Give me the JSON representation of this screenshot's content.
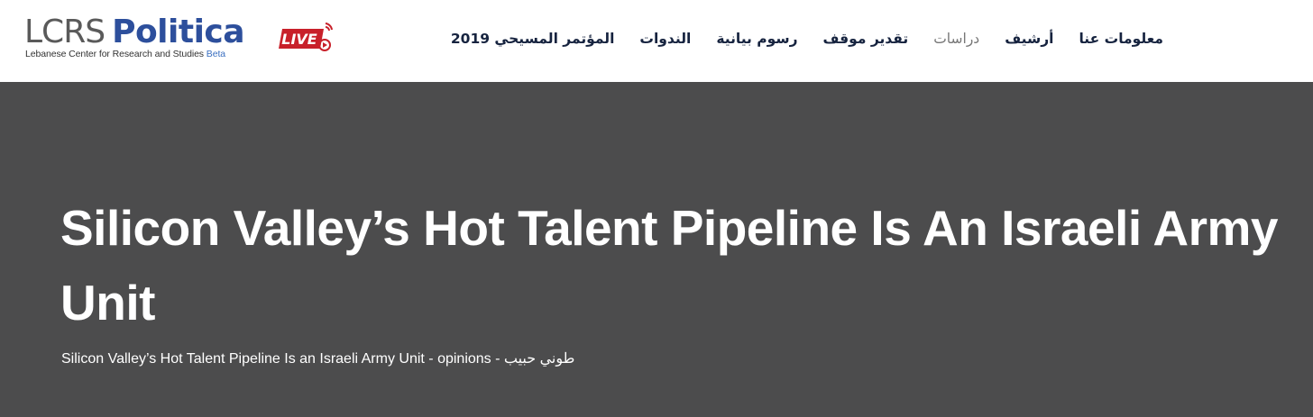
{
  "header": {
    "logo": {
      "lcrs": "LCRS",
      "politica": "Politica",
      "subtitle": "Lebanese Center for Research and Studies",
      "beta": "Beta"
    },
    "live_badge": {
      "label": "LIVE",
      "icon": "live-broadcast-icon",
      "color": "#c8202a"
    },
    "nav": {
      "items": [
        {
          "label": "معلومات عنا"
        },
        {
          "label": "أرشيف"
        },
        {
          "label": "دراسات"
        },
        {
          "label": "تقدير موقف"
        },
        {
          "label": "رسوم بيانية"
        },
        {
          "label": "الندوات"
        },
        {
          "label": "المؤتمر المسيحي 2019"
        }
      ]
    }
  },
  "hero": {
    "background_color": "#4c4c4d",
    "title": "Silicon Valley’s Hot Talent Pipeline Is An Israeli Army Unit",
    "subtitle": "Silicon Valley’s Hot Talent Pipeline Is an Israeli Army Unit - opinions - طوني حبيب"
  },
  "colors": {
    "brand_blue": "#2d4f9c",
    "logo_gray": "#5a5a5a",
    "nav_text": "#16233f",
    "live_red": "#c8202a"
  }
}
